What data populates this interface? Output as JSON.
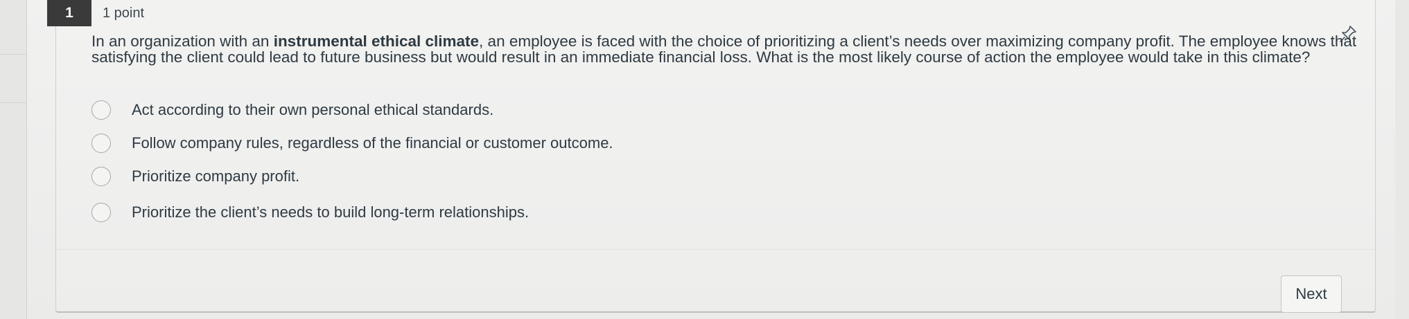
{
  "question": {
    "number": "1",
    "points": "1 point",
    "text_before": "In an organization with an ",
    "text_bold": "instrumental ethical climate",
    "text_after": ", an employee is faced with the choice of prioritizing a client’s needs over maximizing company profit. The employee knows that satisfying the client could lead to future business but would result in an immediate financial loss. What is the most likely course of action the employee would take in this climate?",
    "pin_icon": "pin-icon"
  },
  "answers": [
    {
      "label": "Act according to their own personal ethical standards."
    },
    {
      "label": "Follow company rules, regardless of the financial or customer outcome."
    },
    {
      "label": "Prioritize company profit."
    },
    {
      "label": "Prioritize the client’s needs to build long-term relationships."
    }
  ],
  "footer": {
    "next_label": "Next"
  }
}
